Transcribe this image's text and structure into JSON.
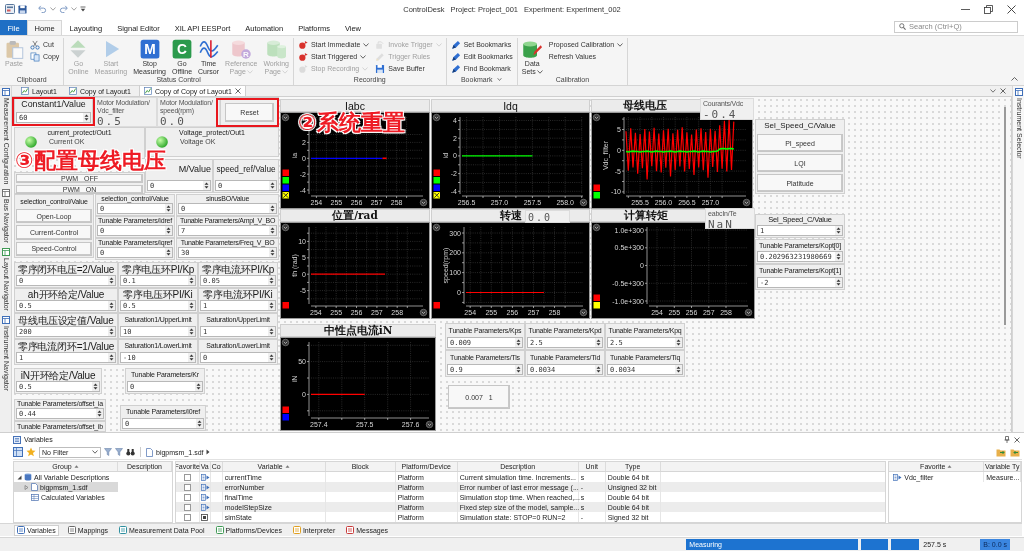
{
  "title_bar": {
    "app_name": "ControlDesk",
    "project": "Project: Project_001",
    "experiment": "Experiment: Experiment_002"
  },
  "menu": {
    "tabs": [
      {
        "label": "File",
        "kind": "file",
        "selected": false
      },
      {
        "label": "Home",
        "kind": "tab",
        "selected": true
      },
      {
        "label": "Layouting",
        "kind": "tab",
        "selected": false
      },
      {
        "label": "Signal Editor",
        "kind": "tab",
        "selected": false
      },
      {
        "label": "XIL API EESPort",
        "kind": "tab",
        "selected": false
      },
      {
        "label": "Automation",
        "kind": "tab",
        "selected": false
      },
      {
        "label": "Platforms",
        "kind": "tab",
        "selected": false
      },
      {
        "label": "View",
        "kind": "tab",
        "selected": false
      }
    ],
    "search": {
      "placeholder": "Search (Ctrl+Q)"
    }
  },
  "ribbon": {
    "groups": [
      {
        "label": "Clipboard",
        "launcher": false,
        "items": [
          {
            "kind": "large",
            "label": "Paste",
            "disabled": true,
            "dropdown": false
          },
          {
            "kind": "small",
            "label": "Cut",
            "disabled": false,
            "dropdown": false
          },
          {
            "kind": "small",
            "label": "Copy",
            "disabled": false,
            "dropdown": false
          }
        ]
      },
      {
        "label": "Status Control",
        "launcher": false,
        "items": [
          {
            "kind": "large",
            "label": "Go Online",
            "disabled": true,
            "dropdown": false
          },
          {
            "kind": "large",
            "label": "Start Measuring",
            "disabled": true,
            "dropdown": false
          },
          {
            "kind": "large",
            "label": "Stop Measuring",
            "disabled": false,
            "dropdown": false,
            "icon_letter": "M"
          },
          {
            "kind": "large",
            "label": "Go Offline",
            "disabled": false,
            "dropdown": false,
            "icon_letter": "C"
          },
          {
            "kind": "large",
            "label": "Time Cursor",
            "disabled": false,
            "dropdown": false
          },
          {
            "kind": "large",
            "label": "Reference Page",
            "disabled": true,
            "dropdown": true,
            "icon_letter": "R"
          },
          {
            "kind": "large",
            "label": "Working Page",
            "disabled": true,
            "dropdown": true
          }
        ]
      },
      {
        "label": "Recording",
        "launcher": false,
        "items": [
          {
            "kind": "small",
            "label": "Start Immediate",
            "disabled": false,
            "dropdown": true
          },
          {
            "kind": "small",
            "label": "Start Triggered",
            "disabled": false,
            "dropdown": true
          },
          {
            "kind": "small",
            "label": "Stop Recording",
            "disabled": true,
            "dropdown": true
          },
          {
            "kind": "small",
            "label": "Invoke Trigger",
            "disabled": true,
            "dropdown": true
          },
          {
            "kind": "small",
            "label": "Trigger Rules",
            "disabled": true,
            "dropdown": false
          },
          {
            "kind": "small",
            "label": "Save Buffer",
            "disabled": false,
            "dropdown": false
          }
        ]
      },
      {
        "label": "Bookmark",
        "launcher": true,
        "items": [
          {
            "kind": "small",
            "label": "Set Bookmarks",
            "disabled": false,
            "dropdown": false
          },
          {
            "kind": "small",
            "label": "Edit Bookmarks",
            "disabled": false,
            "dropdown": false
          },
          {
            "kind": "small",
            "label": "Find Bookmark",
            "disabled": false,
            "dropdown": false
          }
        ]
      },
      {
        "label": "Calibration",
        "launcher": false,
        "items": [
          {
            "kind": "large",
            "label": "Data Sets",
            "disabled": false,
            "dropdown": true
          },
          {
            "kind": "small",
            "label": "Proposed Calibration",
            "disabled": false,
            "dropdown": true
          },
          {
            "kind": "small",
            "label": "Refresh Values",
            "disabled": false,
            "dropdown": false
          }
        ]
      }
    ]
  },
  "document_tabs": [
    {
      "label": "Layout1",
      "selected": false
    },
    {
      "label": "Copy of Layout1",
      "selected": false
    },
    {
      "label": "Copy of Copy of Layout1",
      "selected": true
    }
  ],
  "left_sidebar": [
    "Measurement Configuration",
    "Bus Navigator",
    "Layout Navigator",
    "Instrument Navigator"
  ],
  "right_sidebar": [
    "Instrument Selector"
  ],
  "layout": {
    "instruments": [
      {
        "kind": "numeric",
        "title": "Constant1/Value",
        "value": "60"
      },
      {
        "kind": "display",
        "title": "Motor Modulation/Vdc_filter",
        "value": "0.5"
      },
      {
        "kind": "display",
        "title": "Motor Modulation/speed(rpm)",
        "value": "0.0"
      },
      {
        "kind": "button",
        "label": "Reset"
      },
      {
        "kind": "lamp",
        "title": "current_protect/Out1",
        "on": true,
        "label": "Current OK"
      },
      {
        "kind": "lamp",
        "title": "Voltage_protect/Out1",
        "on": true,
        "label": "Voltage OK"
      },
      {
        "kind": "push_buttons",
        "buttons": [
          "PWM OFF",
          "PWM ON"
        ]
      },
      {
        "kind": "numeric",
        "title": "M/Value",
        "value": "0"
      },
      {
        "kind": "numeric",
        "title": "speed_ref/Value",
        "value": "0"
      },
      {
        "kind": "radio_buttons",
        "title": "selection_control/Value",
        "buttons": [
          "Open-Loop",
          "Current-Control",
          "Speed-Control"
        ]
      },
      {
        "kind": "numeric",
        "title": "selection_control/Value",
        "value": "0"
      },
      {
        "kind": "numeric",
        "title": "Tunable Parameters/idref",
        "value": "0"
      },
      {
        "kind": "numeric",
        "title": "Tunable Parameters/iqref",
        "value": "0"
      },
      {
        "kind": "numeric",
        "title": "sinusBO/Value",
        "value": "0"
      },
      {
        "kind": "numeric",
        "title": "Tunable Parameters/Ampl_V_BO",
        "value": "7"
      },
      {
        "kind": "numeric",
        "title": "Tunable Parameters/Freq_V_BO",
        "value": "30"
      },
      {
        "kind": "numeric",
        "title": "零序闭环电压=2/Value",
        "value": "0"
      },
      {
        "kind": "numeric",
        "title": "零序电压环PI/Kp",
        "value": "0.1"
      },
      {
        "kind": "numeric",
        "title": "零序电流环PI/Kp",
        "value": "0.05"
      },
      {
        "kind": "numeric",
        "title": "ah开环给定/Value",
        "value": "0.5"
      },
      {
        "kind": "numeric",
        "title": "零序电压环PI/Ki",
        "value": "0.5"
      },
      {
        "kind": "numeric",
        "title": "零序电流环PI/Ki",
        "value": "1"
      },
      {
        "kind": "numeric",
        "title": "母线电压设定值/Value",
        "value": "200"
      },
      {
        "kind": "numeric",
        "title": "Saturation1/UpperLimit",
        "value": "10"
      },
      {
        "kind": "numeric",
        "title": "Saturation/UpperLimit",
        "value": "1"
      },
      {
        "kind": "numeric",
        "title": "零序电流闭环=1/Value",
        "value": "1"
      },
      {
        "kind": "numeric",
        "title": "Saturation1/LowerLimit",
        "value": "-10"
      },
      {
        "kind": "numeric",
        "title": "Saturation/LowerLimit",
        "value": "0"
      },
      {
        "kind": "numeric",
        "title": "iN开环给定/Value",
        "value": "0.5"
      },
      {
        "kind": "numeric",
        "title": "Tunable Parameters/Kr",
        "value": "0"
      },
      {
        "kind": "numeric",
        "title": "Tunable Parameters/offset_ia",
        "value": "0.44"
      },
      {
        "kind": "numeric",
        "title": "Tunable Parameters/offset_ib"
      },
      {
        "kind": "numeric",
        "title": "Tunable Parameters/i0ref",
        "value": "0"
      },
      {
        "kind": "chart",
        "chart_data": {
          "type": "line",
          "title": "Iabc",
          "ylabel": "ia",
          "grid": true,
          "x": [
            253.73,
            257.3,
            257.5
          ],
          "series": [
            {
              "color": "#0000ff",
              "values": [
                0,
                0,
                null
              ]
            },
            {
              "color": "#ff0000",
              "values": [
                null,
                0,
                0
              ]
            }
          ],
          "xlim": [
            253.73,
            259.32
          ],
          "ylim": [
            -4.5,
            5.2
          ],
          "xticks": [
            254,
            255,
            256,
            257,
            258
          ],
          "yticks": [
            -4,
            -2,
            0,
            2
          ]
        },
        "legend": [
          {
            "color": "#ff0000",
            "crossed": false
          },
          {
            "color": "#00ff00",
            "crossed": false
          },
          {
            "color": "#0000ff",
            "crossed": false
          },
          {
            "color": "#ffff00",
            "crossed": true
          }
        ]
      },
      {
        "kind": "chart",
        "chart_data": {
          "type": "line",
          "title": "Idq",
          "ylabel": "id",
          "grid": true,
          "x": [
            256.43,
            257.5
          ],
          "series": [
            {
              "color": "#00ff00",
              "values": [
                0,
                0
              ]
            }
          ],
          "xlim": [
            256.43,
            258.27
          ],
          "ylim": [
            -4.3,
            4.4
          ],
          "xticks": [
            256.5,
            {
              "value": 257,
              "label": "257.0"
            },
            257.5,
            {
              "value": 258,
              "label": "258.0"
            }
          ],
          "yticks": [
            -4,
            -2,
            0,
            2,
            4
          ]
        },
        "legend": [
          {
            "color": "#ff0000",
            "crossed": false
          },
          {
            "color": "#00ff00",
            "crossed": false
          },
          {
            "color": "#0000ff",
            "crossed": false
          },
          {
            "color": "#ffff00",
            "crossed": true
          }
        ]
      },
      {
        "kind": "chart",
        "chart_data": {
          "type": "line",
          "title": "母线电压",
          "ylabel": "Vdc_filter",
          "grid": true,
          "x": [
            255.2,
            255.25,
            255.3,
            255.35,
            255.4,
            255.45,
            255.5,
            255.55,
            255.6,
            255.65,
            255.7,
            255.75,
            255.8,
            255.85,
            255.9,
            255.95,
            256,
            256.05,
            256.1,
            256.15,
            256.2,
            256.25,
            256.3,
            256.35,
            256.4,
            256.45,
            256.5,
            256.55,
            256.6,
            256.65,
            256.7,
            256.75,
            256.8,
            256.85,
            256.9,
            256.95,
            257,
            257.05,
            257.1,
            257.15,
            257.2,
            257.25,
            257.3,
            257.35,
            257.4,
            257.45,
            257.5
          ],
          "series": [
            {
              "color": "#ff0000",
              "values": [
                4.6,
                -4.9,
                5.3,
                -4.1,
                4.2,
                -5.6,
                3.9,
                -4.3,
                5.1,
                -7.0,
                4.5,
                -3.8,
                5.4,
                -5.0,
                4.0,
                -5.3,
                4.8,
                -4.2,
                5.2,
                -6.3,
                4.1,
                -4.7,
                4.9,
                -3.9,
                5.5,
                -5.1,
                4.3,
                -4.5,
                3.8,
                -5.9,
                5.0,
                -4.1,
                5.3,
                -4.8,
                4.4,
                -6.6,
                5.1,
                -4.0,
                4.7,
                -5.2,
                6.0,
                -4.4,
                7.1,
                -5.1,
                7.3,
                -4.7,
                6.9
              ]
            },
            {
              "color": "#00ff00",
              "values": [
                -0.3,
                -0.4,
                -0.3,
                -0.2,
                -0.3,
                -0.3,
                -0.4,
                -0.3,
                -0.3,
                -0.2,
                -0.3,
                -0.4,
                -0.3,
                -0.2,
                -0.3,
                -0.3,
                -0.4,
                -0.3,
                -0.3,
                -0.2,
                -0.3,
                -0.4,
                -0.3,
                -0.2,
                -0.3,
                -0.3,
                -0.4,
                -0.3,
                -0.3,
                -0.2,
                -0.3,
                -0.4,
                -0.3,
                -0.2,
                -0.3,
                -0.3,
                -0.4,
                -0.3,
                -0.3,
                -0.2,
                0.3,
                0.4,
                0.4,
                0.3,
                0.4,
                0.4,
                0.3
              ]
            }
          ],
          "xlim": [
            255.2,
            257.76
          ],
          "ylim": [
            -10.5,
            8
          ],
          "xticks": [
            255.5,
            {
              "value": 256,
              "label": "256.0"
            },
            256.5,
            {
              "value": 257,
              "label": "257.0"
            }
          ],
          "yticks": [
            -10,
            -5,
            0,
            5
          ]
        },
        "legend": [
          {
            "color": "#ff0000",
            "crossed": false
          },
          {
            "color": "#00ff00",
            "crossed": false
          }
        ]
      },
      {
        "kind": "display",
        "title": "Courants/Vdc",
        "value": "-0.4"
      },
      {
        "kind": "chart",
        "chart_data": {
          "type": "line",
          "title": "位置/rad",
          "ylabel": "th (rad)",
          "grid": true,
          "x": [
            253.76,
            257.4
          ],
          "series": [
            {
              "color": "#ff0000",
              "values": [
                0,
                0
              ]
            }
          ],
          "xlim": [
            253.76,
            259.27
          ],
          "ylim": [
            -9.1,
            14.4
          ],
          "xticks": [
            254,
            255,
            256,
            257,
            258
          ],
          "yticks": [
            -5,
            0,
            5,
            10
          ]
        },
        "legend": [
          {
            "color": "#ff0000",
            "crossed": false
          }
        ]
      },
      {
        "kind": "chart",
        "chart_data": {
          "type": "line",
          "title": "转速",
          "ylabel": "speed(rpm)",
          "grid": true,
          "x": [
            253.8,
            257.5
          ],
          "series": [
            {
              "color": "#ff0000",
              "values": [
                0,
                0
              ]
            }
          ],
          "xlim": [
            253.8,
            259.35
          ],
          "ylim": [
            -58,
            330
          ],
          "xticks": [
            254,
            255,
            256,
            257,
            258
          ],
          "yticks": [
            0,
            100,
            200,
            300
          ]
        },
        "legend": [
          {
            "color": "#ff0000",
            "crossed": false
          }
        ]
      },
      {
        "kind": "display",
        "value": "0.0"
      },
      {
        "kind": "chart",
        "title": "计算转矩",
        "y_labels": [
          "1.0e+300",
          "0.5e+300",
          "0",
          "-0.5e+300",
          "-1.0e+300"
        ],
        "x_labels": [
          "254",
          "255",
          "256",
          "257",
          "258"
        ],
        "legend": [
          {
            "color": "#ff0000",
            "crossed": false
          },
          {
            "color": "#ffff00",
            "crossed": false
          }
        ]
      },
      {
        "kind": "display",
        "title": "eabcIn/Te",
        "value": "NaN"
      },
      {
        "kind": "radio_buttons",
        "title": "Sel_Speed_C/Value",
        "buttons": [
          "PI_speed",
          "LQI",
          "Platitude"
        ]
      },
      {
        "kind": "numeric",
        "title": "Sel_Speed_C/Value",
        "value": "1"
      },
      {
        "kind": "numeric",
        "title": "Tunable Parameters/Kopt[0]",
        "value": "0.202963231980669"
      },
      {
        "kind": "numeric",
        "title": "Tunable Parameters/Kopt[1]",
        "value": "-2"
      },
      {
        "kind": "chart",
        "chart_data": {
          "type": "line",
          "title": "中性点电流iN",
          "ylabel": "iN",
          "grid": true,
          "x": [
            257.383,
            257.5
          ],
          "series": [
            {
              "color": "#ff0000",
              "values": [
                0,
                0
              ]
            }
          ],
          "xlim": [
            257.383,
            257.64
          ],
          "ylim": [
            -33,
            80
          ],
          "xticks": [
            257.4,
            257.5,
            257.6
          ],
          "yticks": [
            0,
            50
          ]
        },
        "legend": [
          {
            "color": "#ff0000",
            "crossed": false
          },
          {
            "color": "#0000ff",
            "crossed": false
          }
        ]
      },
      {
        "kind": "numeric",
        "title": "Tunable Parameters/Kps",
        "value": "0.009"
      },
      {
        "kind": "numeric",
        "title": "Tunable Parameters/Kpd",
        "value": "2.5"
      },
      {
        "kind": "numeric",
        "title": "Tunable Parameters/Kpq",
        "value": "2.5"
      },
      {
        "kind": "numeric",
        "title": "Tunable Parameters/Tis",
        "value": "0.9"
      },
      {
        "kind": "numeric",
        "title": "Tunable Parameters/Tid",
        "value": "0.0034"
      },
      {
        "kind": "numeric",
        "title": "Tunable Parameters/Tiq",
        "value": "0.0034"
      },
      {
        "kind": "button",
        "label": "0.007 1"
      }
    ],
    "annotations": [
      {
        "kind": "box"
      },
      {
        "kind": "box"
      },
      {
        "kind": "note",
        "text": "②系统重置"
      },
      {
        "kind": "note",
        "text": "③配置母线电压"
      }
    ]
  },
  "variables_pane": {
    "title": "Variables",
    "filter": "No Filter",
    "breadcrumb": "bigpmsm_1.sdf",
    "group_tree": {
      "columns": [
        "Group",
        "Description"
      ],
      "items": [
        {
          "label": "All Variable Descriptions",
          "expanded": true,
          "selected": false,
          "children": [
            {
              "label": "bigpmsm_1.sdf",
              "expanded": false,
              "selected": true
            },
            {
              "label": "Calculated Variables",
              "selected": false
            }
          ]
        }
      ]
    },
    "table": {
      "columns": [
        "Favorite",
        "Va",
        "Co",
        "Variable",
        "Block",
        "Platform/Device",
        "Description",
        "Unit",
        "Type"
      ],
      "rows": [
        {
          "favorite": false,
          "kind": "measurement",
          "variable": "currentTime",
          "platform": "Platform",
          "description": "Current simulation time. Increments...",
          "unit": "s",
          "type": "Double 64 bit"
        },
        {
          "favorite": false,
          "kind": "measurement",
          "variable": "errorNumber",
          "platform": "Platform",
          "description": "Error number of last error message (...",
          "unit": "-",
          "type": "Unsigned 32 bit"
        },
        {
          "favorite": false,
          "kind": "measurement",
          "variable": "finalTime",
          "platform": "Platform",
          "description": "Simulation stop time. When reached,...",
          "unit": "s",
          "type": "Double 64 bit"
        },
        {
          "favorite": false,
          "kind": "measurement",
          "variable": "modelStepSize",
          "platform": "Platform",
          "description": "Fixed step size of the model, sample...",
          "unit": "s",
          "type": "Double 64 bit"
        },
        {
          "favorite": false,
          "kind": "parameter",
          "variable": "simState",
          "platform": "Platform",
          "description": "Simulation state: STOP=0 RUN=2",
          "unit": "-",
          "type": "Signed 32 bit"
        }
      ]
    },
    "favorites": {
      "columns": [
        "Favorite",
        "Variable Ty"
      ],
      "rows": [
        {
          "variable": "Vdc_filter",
          "type": "Measure..."
        }
      ]
    },
    "tabs": [
      {
        "label": "Variables",
        "selected": true
      },
      {
        "label": "Mappings",
        "selected": false
      },
      {
        "label": "Measurement Data Pool",
        "selected": false
      },
      {
        "label": "Platforms/Devices",
        "selected": false
      },
      {
        "label": "Interpreter",
        "selected": false
      },
      {
        "label": "Messages",
        "selected": false
      }
    ]
  },
  "status_bar": {
    "mode": "Measuring",
    "time": "257.5 s",
    "indicator": "B: 0.0 s"
  }
}
